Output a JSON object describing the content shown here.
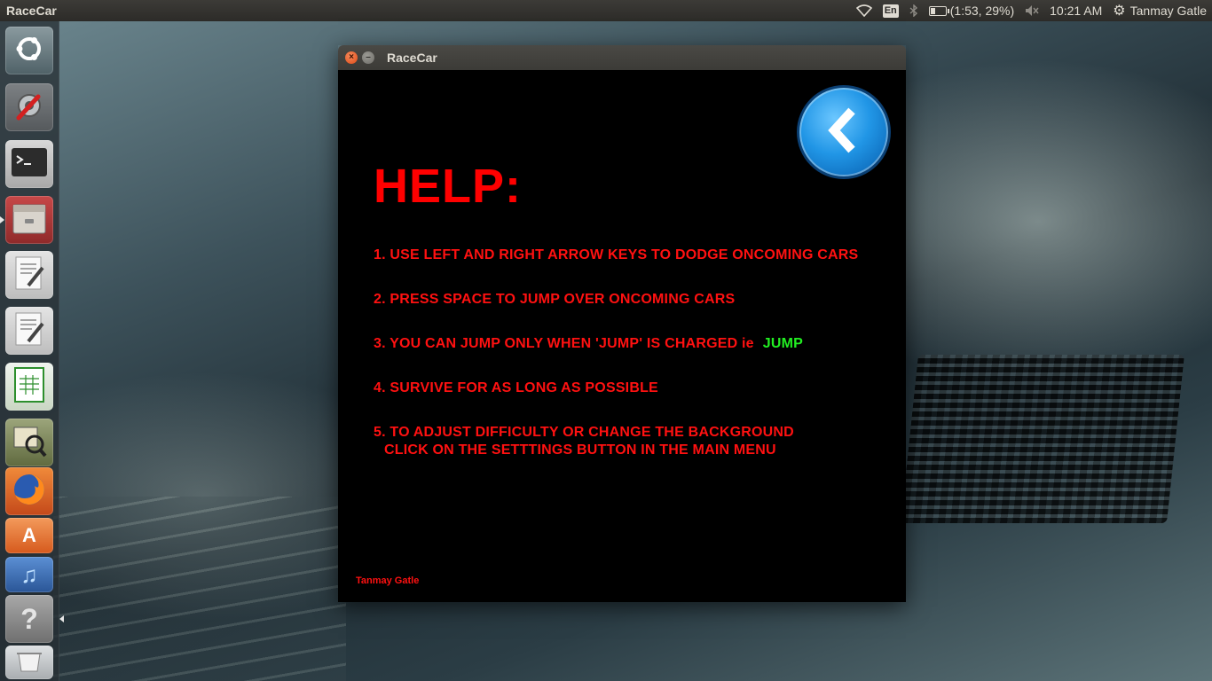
{
  "top_panel": {
    "app_title": "RaceCar",
    "keyboard_layout": "En",
    "battery_status": "(1:53, 29%)",
    "battery_level": 0.29,
    "clock": "10:21 AM",
    "user_name": "Tanmay Gatle"
  },
  "launcher": {
    "items": [
      {
        "name": "ubuntu-dash-icon",
        "color": "#5a6b70"
      },
      {
        "name": "system-settings-icon",
        "color": "#6b6f72"
      },
      {
        "name": "terminal-icon",
        "color": "#2c2c2c"
      },
      {
        "name": "file-manager-icon",
        "color": "#b23a3a"
      },
      {
        "name": "text-editor-icon",
        "color": "#d8d8d8"
      },
      {
        "name": "text-editor-2-icon",
        "color": "#d8d8d8"
      },
      {
        "name": "spreadsheet-icon",
        "color": "#e9f2e4"
      },
      {
        "name": "image-viewer-icon",
        "color": "#6f7a52"
      },
      {
        "name": "firefox-icon",
        "color": "#e86b1f"
      },
      {
        "name": "software-center-icon",
        "color": "#e8732c"
      },
      {
        "name": "music-player-icon",
        "color": "#3a6fb5"
      },
      {
        "name": "help-icon",
        "color": "#8a8a8a"
      },
      {
        "name": "trash-icon",
        "color": "#cfd2d4"
      }
    ]
  },
  "window": {
    "title": "RaceCar",
    "help": {
      "heading": "HELP:",
      "lines": [
        "1. USE LEFT AND RIGHT ARROW KEYS TO DODGE ONCOMING CARS",
        "2. PRESS SPACE TO JUMP OVER ONCOMING CARS",
        "3. YOU CAN JUMP ONLY WHEN 'JUMP' IS CHARGED ie",
        "4. SURVIVE FOR AS LONG AS POSSIBLE",
        "5. TO ADJUST DIFFICULTY OR CHANGE THE BACKGROUND",
        "CLICK ON THE SETTTINGS BUTTON IN THE MAIN MENU"
      ],
      "jump_indicator": "JUMP",
      "author": "Tanmay Gatle"
    },
    "colors": {
      "help_text": "#ff1111",
      "jump_charged": "#22ee22",
      "back_button": "#2196e6"
    }
  }
}
